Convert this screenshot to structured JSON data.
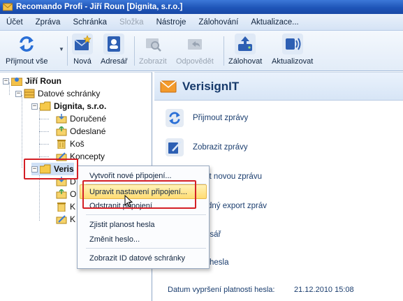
{
  "window": {
    "title": "Recomando Profi - Jiří Roun [Dignita, s.r.o.]"
  },
  "menu": [
    {
      "label": "Účet",
      "disabled": false
    },
    {
      "label": "Zpráva",
      "disabled": false
    },
    {
      "label": "Schránka",
      "disabled": false
    },
    {
      "label": "Složka",
      "disabled": true
    },
    {
      "label": "Nástroje",
      "disabled": false
    },
    {
      "label": "Zálohování",
      "disabled": false
    },
    {
      "label": "Aktualizace...",
      "disabled": false
    }
  ],
  "toolbar": {
    "receive_all": "Přijmout vše",
    "new": "Nová",
    "address_book": "Adresář",
    "show": "Zobrazit",
    "reply": "Odpovědět",
    "backup": "Zálohovat",
    "update": "Aktualizovat"
  },
  "tree": {
    "user": "Jiří Roun",
    "mailboxes": "Datové schránky",
    "company": "Dignita, s.r.o.",
    "folders": [
      "Doručené",
      "Odeslané",
      "Koš",
      "Koncepty"
    ],
    "second_box": "VerisignIT",
    "second_box_visible": "Veris",
    "second_box_children_partial": [
      "D",
      "O",
      "K",
      "K"
    ]
  },
  "content": {
    "title": "VerisignIT",
    "actions": [
      "Přijmout zprávy",
      "Zobrazit zprávy",
      "vořit novou zprávu",
      "madný export zpráv",
      "esář",
      "na hesla"
    ],
    "password_expiry_label": "Datum vypršení platnosti hesla:",
    "password_expiry_value": "21.12.2010 15:08"
  },
  "context_menu": {
    "items": [
      "Vytvořit nové připojení...",
      "Upravit nastavení připojení...",
      "Odstranit připojení",
      "Zjistit planost hesla",
      "Změnit heslo...",
      "Zobrazit ID datové schránky"
    ],
    "highlighted_index": 1
  },
  "colors": {
    "accent_blue": "#1f55b8",
    "annotation_red": "#d41f26",
    "highlight": "#ffdc73"
  }
}
